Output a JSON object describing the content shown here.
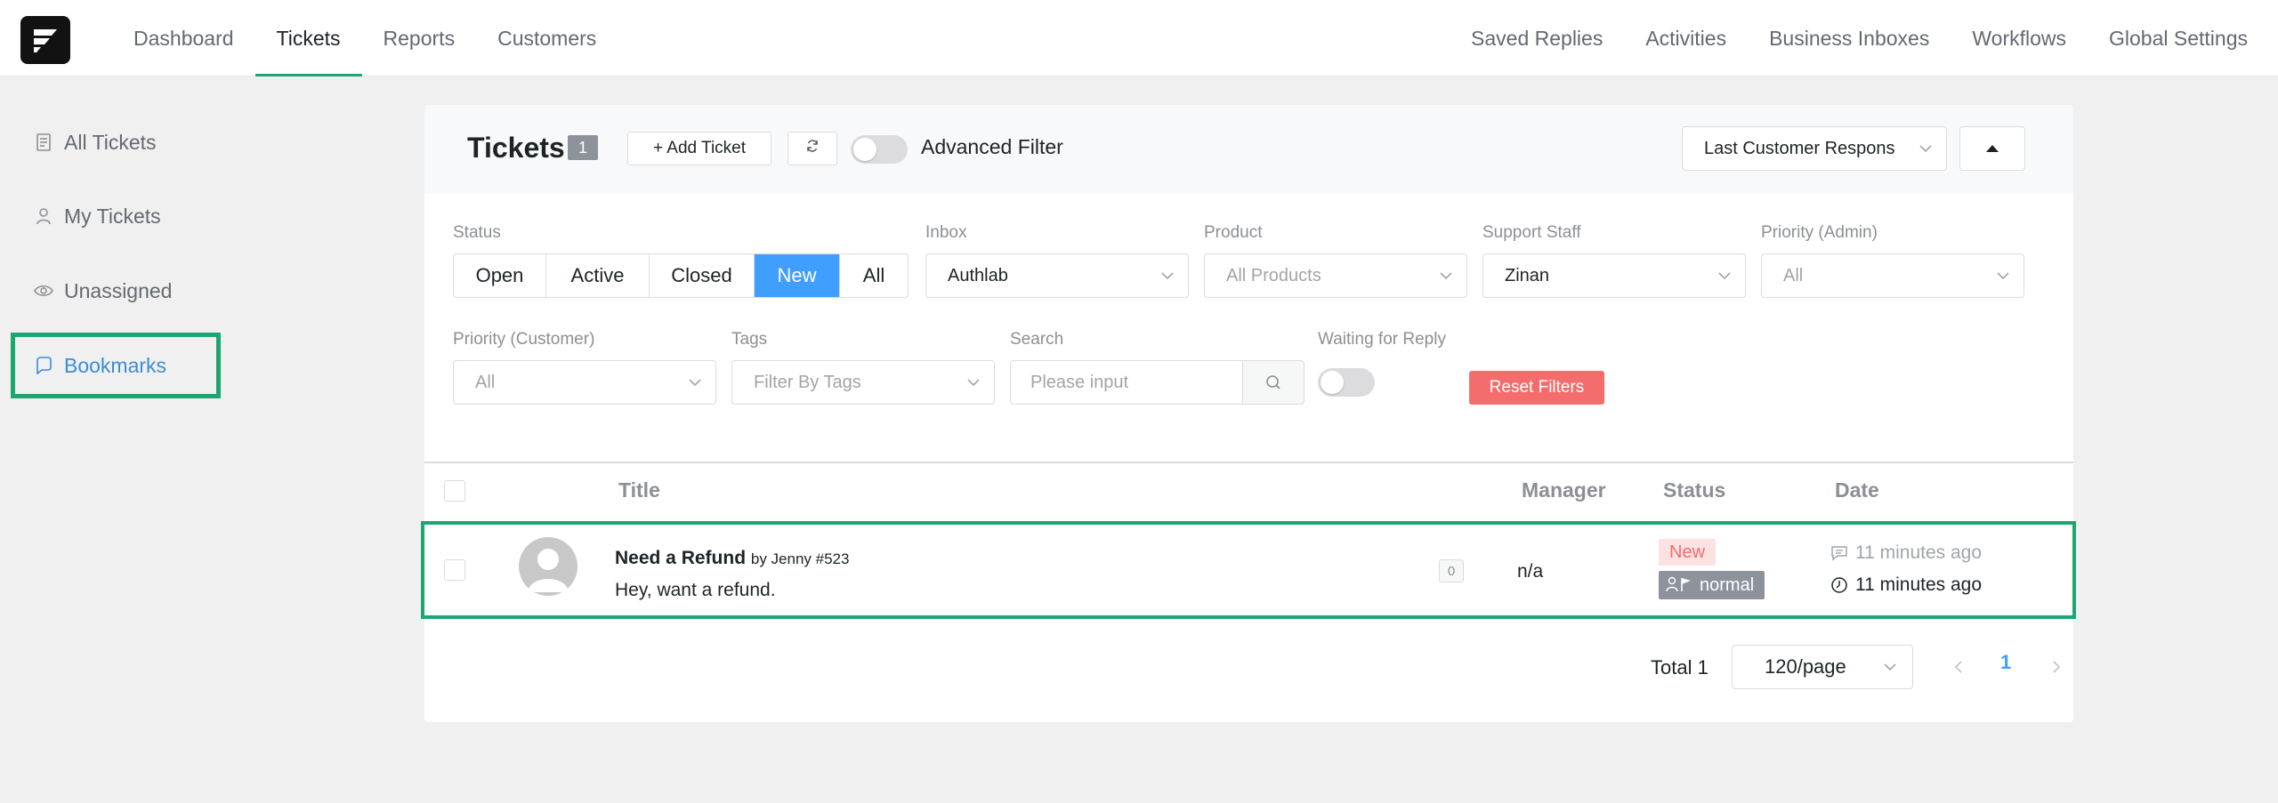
{
  "topnav": {
    "left": [
      "Dashboard",
      "Tickets",
      "Reports",
      "Customers"
    ],
    "right": [
      "Saved Replies",
      "Activities",
      "Business Inboxes",
      "Workflows",
      "Global Settings"
    ]
  },
  "sidebar": {
    "items": [
      {
        "label": "All Tickets",
        "icon": "document-icon"
      },
      {
        "label": "My Tickets",
        "icon": "user-icon"
      },
      {
        "label": "Unassigned",
        "icon": "eye-icon"
      },
      {
        "label": "Bookmarks",
        "icon": "bookmark-icon"
      }
    ]
  },
  "header": {
    "title": "Tickets",
    "count": "1",
    "add_ticket": "+ Add Ticket",
    "advanced_filter": "Advanced Filter",
    "sort_select": "Last Customer Respons"
  },
  "filters": {
    "status_label": "Status",
    "status_options": [
      "Open",
      "Active",
      "Closed",
      "New",
      "All"
    ],
    "inbox_label": "Inbox",
    "inbox_value": "Authlab",
    "product_label": "Product",
    "product_placeholder": "All Products",
    "staff_label": "Support Staff",
    "staff_value": "Zinan",
    "priority_admin_label": "Priority (Admin)",
    "priority_admin_placeholder": "All",
    "priority_customer_label": "Priority (Customer)",
    "priority_customer_placeholder": "All",
    "tags_label": "Tags",
    "tags_placeholder": "Filter By Tags",
    "search_label": "Search",
    "search_placeholder": "Please input",
    "waiting_label": "Waiting for Reply",
    "reset": "Reset Filters"
  },
  "table": {
    "columns": [
      "Title",
      "Manager",
      "Status",
      "Date"
    ],
    "rows": [
      {
        "title": "Need a Refund",
        "by": "by Jenny #523",
        "excerpt": "Hey, want a refund.",
        "responses": "0",
        "manager": "n/a",
        "status": "New",
        "priority": "normal",
        "last_response": "11 minutes ago",
        "created": "11 minutes ago"
      }
    ]
  },
  "pagination": {
    "total": "Total 1",
    "page_size": "120/page",
    "current_page": "1"
  },
  "colors": {
    "accent_green": "#1ea672",
    "primary_blue": "#409eff",
    "danger_red": "#f56c6c"
  }
}
